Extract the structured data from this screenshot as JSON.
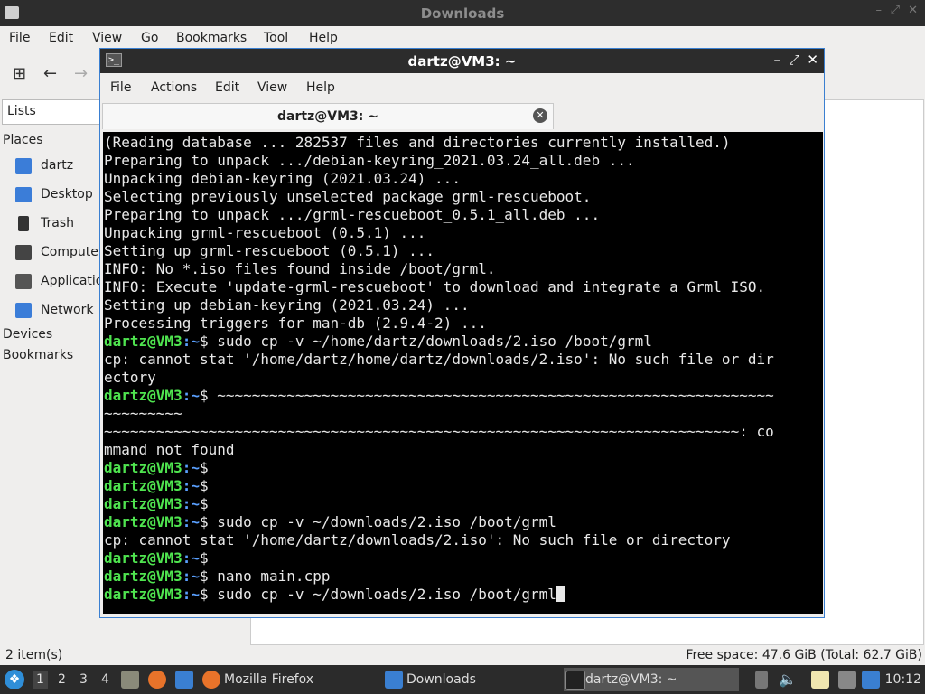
{
  "file_manager": {
    "title": "Downloads",
    "menu": [
      "File",
      "Edit",
      "View",
      "Go",
      "Bookmarks",
      "Tool",
      "Help"
    ],
    "side_select": "Lists",
    "sections": {
      "places": "Places",
      "devices": "Devices",
      "bookmarks": "Bookmarks"
    },
    "places": [
      {
        "label": "dartz",
        "icon": "home-folder-icon",
        "color": "#3b7dd8"
      },
      {
        "label": "Desktop",
        "icon": "desktop-icon",
        "color": "#3b7dd8"
      },
      {
        "label": "Trash",
        "icon": "trash-icon",
        "color": "#333333"
      },
      {
        "label": "Computer",
        "icon": "computer-icon",
        "color": "#444444"
      },
      {
        "label": "Applications",
        "icon": "applications-icon",
        "color": "#555555"
      },
      {
        "label": "Network",
        "icon": "network-icon",
        "color": "#3b7dd8"
      }
    ],
    "status_left": "2 item(s)",
    "status_right": "Free space: 47.6 GiB (Total: 62.7 GiB)"
  },
  "terminal": {
    "title": "dartz@VM3: ~",
    "menu": [
      "File",
      "Actions",
      "Edit",
      "View",
      "Help"
    ],
    "tab_label": "dartz@VM3: ~",
    "prompt_user": "dartz@VM3",
    "prompt_path": ":~",
    "lines": [
      {
        "t": "out",
        "text": "(Reading database ... 282537 files and directories currently installed.)"
      },
      {
        "t": "out",
        "text": "Preparing to unpack .../debian-keyring_2021.03.24_all.deb ..."
      },
      {
        "t": "out",
        "text": "Unpacking debian-keyring (2021.03.24) ..."
      },
      {
        "t": "out",
        "text": "Selecting previously unselected package grml-rescueboot."
      },
      {
        "t": "out",
        "text": "Preparing to unpack .../grml-rescueboot_0.5.1_all.deb ..."
      },
      {
        "t": "out",
        "text": "Unpacking grml-rescueboot (0.5.1) ..."
      },
      {
        "t": "out",
        "text": "Setting up grml-rescueboot (0.5.1) ..."
      },
      {
        "t": "out",
        "text": "INFO: No *.iso files found inside /boot/grml."
      },
      {
        "t": "out",
        "text": "INFO: Execute 'update-grml-rescueboot' to download and integrate a Grml ISO."
      },
      {
        "t": "out",
        "text": "Setting up debian-keyring (2021.03.24) ..."
      },
      {
        "t": "out",
        "text": "Processing triggers for man-db (2.9.4-2) ..."
      },
      {
        "t": "cmd",
        "text": "$ sudo cp -v ~/home/dartz/downloads/2.iso /boot/grml"
      },
      {
        "t": "out",
        "text": "cp: cannot stat '/home/dartz/home/dartz/downloads/2.iso': No such file or dir"
      },
      {
        "t": "out",
        "text": "ectory"
      },
      {
        "t": "cmd",
        "text": "$ ~~~~~~~~~~~~~~~~~~~~~~~~~~~~~~~~~~~~~~~~~~~~~~~~~~~~~~~~~~~~~~~~"
      },
      {
        "t": "out",
        "text": "~~~~~~~~~"
      },
      {
        "t": "out",
        "text": "~~~~~~~~~~~~~~~~~~~~~~~~~~~~~~~~~~~~~~~~~~~~~~~~~~~~~~~~~~~~~~~~~~~~~~~~~: co"
      },
      {
        "t": "out",
        "text": "mmand not found"
      },
      {
        "t": "cmd",
        "text": "$"
      },
      {
        "t": "cmd",
        "text": "$"
      },
      {
        "t": "cmd",
        "text": "$"
      },
      {
        "t": "cmd",
        "text": "$ sudo cp -v ~/downloads/2.iso /boot/grml"
      },
      {
        "t": "out",
        "text": "cp: cannot stat '/home/dartz/downloads/2.iso': No such file or directory"
      },
      {
        "t": "cmd",
        "text": "$"
      },
      {
        "t": "cmd",
        "text": "$ nano main.cpp"
      },
      {
        "t": "cur",
        "text": "$ sudo cp -v ~/downloads/2.iso /boot/grml"
      }
    ]
  },
  "taskbar": {
    "workspaces": [
      "1",
      "2",
      "3",
      "4"
    ],
    "tasks": [
      "Mozilla Firefox",
      "Downloads",
      "dartz@VM3: ~"
    ],
    "clock": "10:12"
  },
  "colors": {
    "accent": "#3a7fd1",
    "prompt_user": "#4fe44f",
    "prompt_path": "#5aa0ff"
  }
}
